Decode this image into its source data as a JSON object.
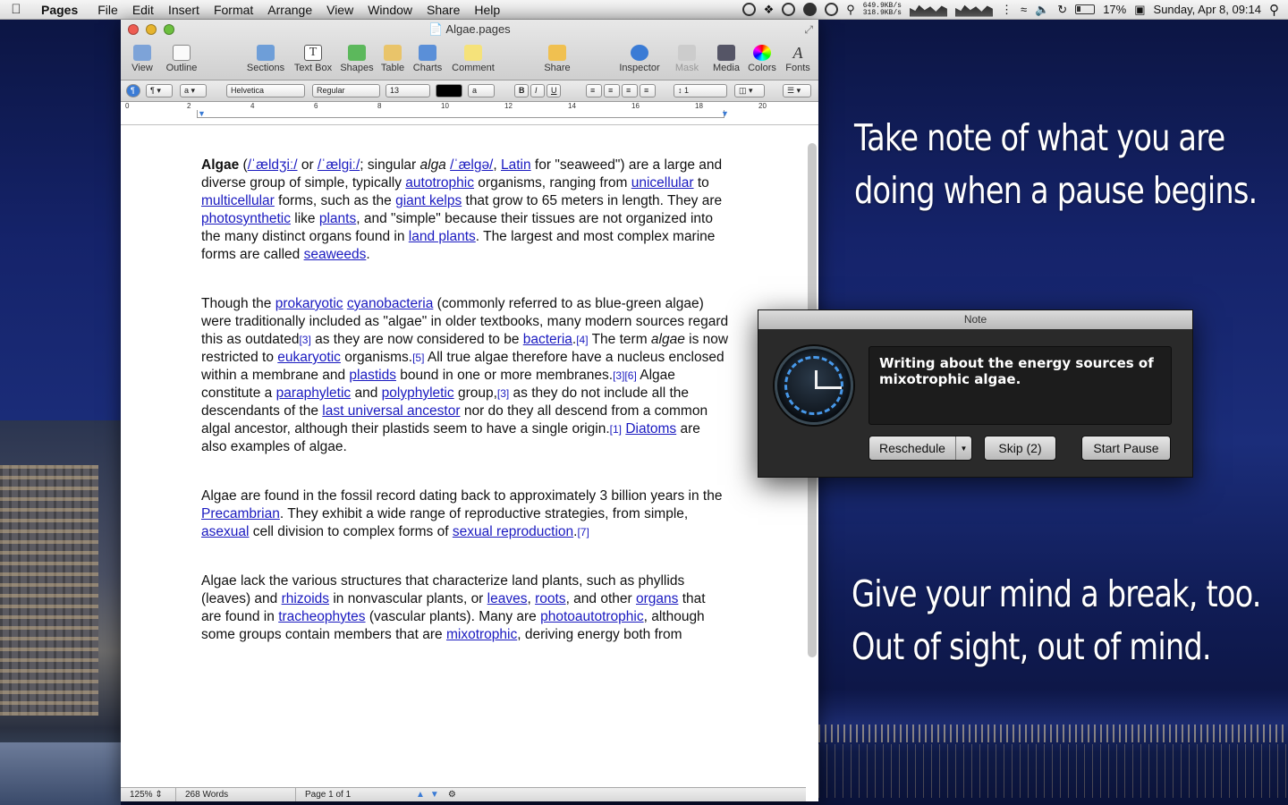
{
  "menubar": {
    "app_name": "Pages",
    "menus": [
      "File",
      "Edit",
      "Insert",
      "Format",
      "Arrange",
      "View",
      "Window",
      "Share",
      "Help"
    ],
    "net_down": "649.9KB/s",
    "net_up": "318.9KB/s",
    "battery": "17%",
    "datetime": "Sunday, Apr 8, 09:14"
  },
  "window": {
    "title": "Algae.pages",
    "toolbar": [
      "View",
      "Outline",
      "Sections",
      "Text Box",
      "Shapes",
      "Table",
      "Charts",
      "Comment",
      "Share",
      "Inspector",
      "Mask",
      "Media",
      "Colors",
      "Fonts"
    ],
    "format": {
      "font": "Helvetica",
      "style": "Regular",
      "size": "13",
      "line_spacing": "1"
    },
    "ruler_numbers": [
      "0",
      "2",
      "4",
      "6",
      "8",
      "10",
      "12",
      "14",
      "16",
      "18",
      "20"
    ],
    "status": {
      "zoom": "125%",
      "words": "268 Words",
      "page": "Page 1 of 1"
    }
  },
  "document": {
    "p1": [
      {
        "b": "Algae"
      },
      {
        "t": " ("
      },
      {
        "a": "/ˈældʒiː/"
      },
      {
        "t": " or "
      },
      {
        "a": "/ˈælɡiː/"
      },
      {
        "t": "; singular "
      },
      {
        "i": "alga"
      },
      {
        "t": " "
      },
      {
        "a": "/ˈælɡə/"
      },
      {
        "t": ", "
      },
      {
        "a": "Latin"
      },
      {
        "t": " for \"seaweed\") are a large and diverse group of simple, typically "
      },
      {
        "a": "autotrophic"
      },
      {
        "t": " organisms, ranging from "
      },
      {
        "a": "unicellular"
      },
      {
        "t": " to "
      },
      {
        "a": "multicellular"
      },
      {
        "t": " forms, such as the "
      },
      {
        "a": "giant kelps"
      },
      {
        "t": " that grow to 65 meters in length. They are "
      },
      {
        "a": "photosynthetic"
      },
      {
        "t": " like "
      },
      {
        "a": "plants"
      },
      {
        "t": ", and \"simple\" because their tissues are not organized into the many distinct organs found in "
      },
      {
        "a": "land plants"
      },
      {
        "t": ". The largest and most complex marine forms are called "
      },
      {
        "a": "seaweeds"
      },
      {
        "t": "."
      }
    ],
    "p2": [
      {
        "t": "Though the "
      },
      {
        "a": "prokaryotic"
      },
      {
        "t": " "
      },
      {
        "a": "cyanobacteria"
      },
      {
        "t": " (commonly referred to as blue-green algae) were traditionally included as \"algae\" in older textbooks, many modern sources regard this as outdated"
      },
      {
        "s": "[3]"
      },
      {
        "t": " as they are now considered to be "
      },
      {
        "a": "bacteria"
      },
      {
        "t": "."
      },
      {
        "s": "[4]"
      },
      {
        "t": " The term "
      },
      {
        "i": "algae"
      },
      {
        "t": " is now restricted to "
      },
      {
        "a": "eukaryotic"
      },
      {
        "t": " organisms."
      },
      {
        "s": "[5]"
      },
      {
        "t": " All true algae therefore have a nucleus enclosed within a membrane and "
      },
      {
        "a": "plastids"
      },
      {
        "t": " bound in one or more membranes."
      },
      {
        "s": "[3][6]"
      },
      {
        "t": " Algae constitute a "
      },
      {
        "a": "paraphyletic"
      },
      {
        "t": " and "
      },
      {
        "a": "polyphyletic"
      },
      {
        "t": " group,"
      },
      {
        "s": "[3]"
      },
      {
        "t": " as they do not include all the descendants of the "
      },
      {
        "a": "last universal ancestor"
      },
      {
        "t": " nor do they all descend from a common algal ancestor, although their plastids seem to have a single origin."
      },
      {
        "s": "[1]"
      },
      {
        "t": " "
      },
      {
        "a": "Diatoms"
      },
      {
        "t": " are also examples of algae."
      }
    ],
    "p3": [
      {
        "t": "Algae are found in the fossil record dating back to approximately 3 billion years in the "
      },
      {
        "a": "Precambrian"
      },
      {
        "t": ". They exhibit a wide range of reproductive strategies, from simple, "
      },
      {
        "a": "asexual"
      },
      {
        "t": " cell division to complex forms of "
      },
      {
        "a": "sexual reproduction"
      },
      {
        "t": "."
      },
      {
        "s": "[7]"
      }
    ],
    "p4": [
      {
        "t": "Algae lack the various structures that characterize land plants, such as phyllids (leaves) and "
      },
      {
        "a": "rhizoids"
      },
      {
        "t": " in nonvascular plants, or "
      },
      {
        "a": "leaves"
      },
      {
        "t": ", "
      },
      {
        "a": "roots"
      },
      {
        "t": ", and other "
      },
      {
        "a": "organs"
      },
      {
        "t": " that are found in "
      },
      {
        "a": "tracheophytes"
      },
      {
        "t": " (vascular plants). Many are "
      },
      {
        "a": "photoautotrophic"
      },
      {
        "t": ", although some groups contain members that are "
      },
      {
        "a": "mixotrophic"
      },
      {
        "t": ", deriving energy both from"
      }
    ]
  },
  "tagline_top": "Take note of what you are\ndoing when a pause begins.",
  "tagline_bottom": "Give your mind a break, too.\nOut of sight, out of mind.",
  "note": {
    "title": "Note",
    "text": "Writing about the energy sources of mixotrophic algae.",
    "reschedule": "Reschedule",
    "skip": "Skip (2)",
    "start": "Start Pause"
  }
}
